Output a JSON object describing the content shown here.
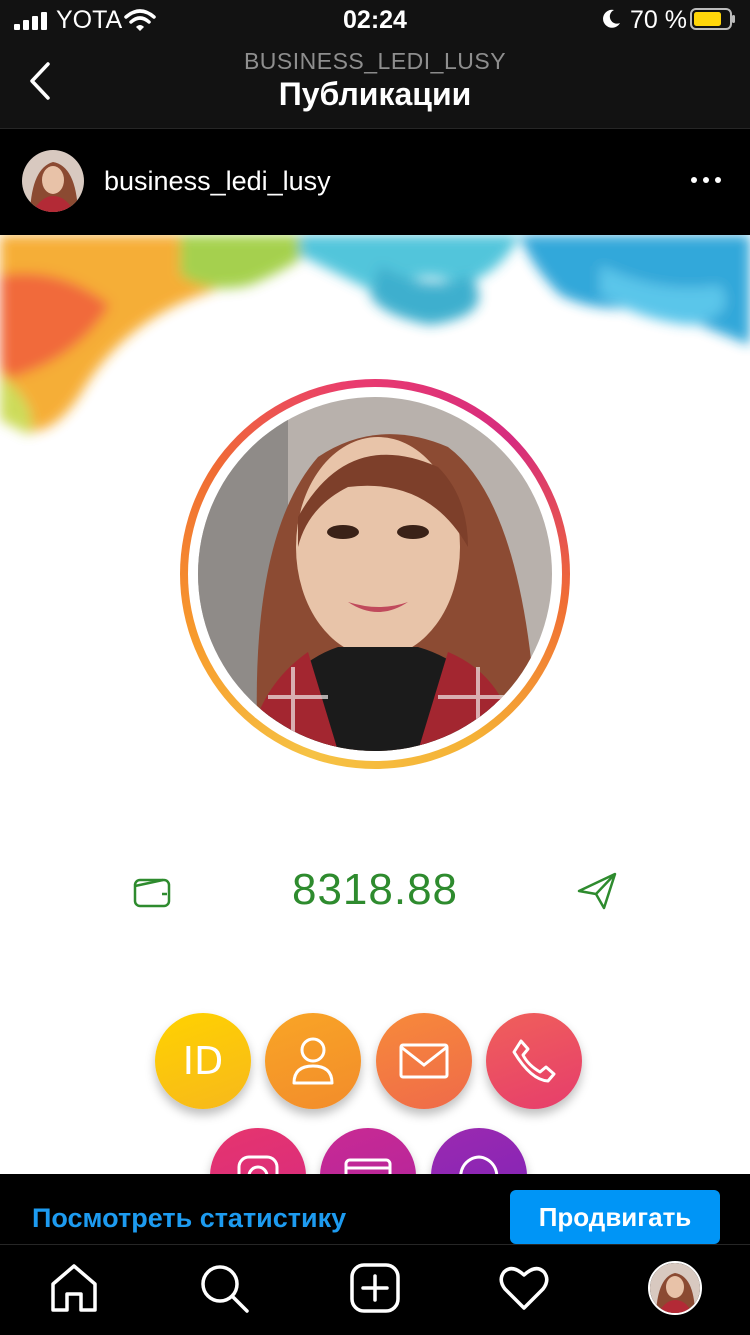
{
  "status_bar": {
    "carrier": "YOTA",
    "time": "02:24",
    "battery_percent": "70 %",
    "icons": [
      "signal-icon",
      "wifi-icon",
      "moon-icon",
      "battery-icon"
    ]
  },
  "nav": {
    "subtitle": "BUSINESS_LEDI_LUSY",
    "title": "Публикации"
  },
  "post": {
    "username": "business_ledi_lusy",
    "balance": "8318.88",
    "circle_buttons": [
      {
        "icon": "id-icon",
        "label": "ID"
      },
      {
        "icon": "user-icon"
      },
      {
        "icon": "mail-icon"
      },
      {
        "icon": "phone-icon"
      },
      {
        "icon": "instagram-icon"
      },
      {
        "icon": "card-icon"
      },
      {
        "icon": "whatsapp-icon"
      }
    ]
  },
  "actions": {
    "stats_link": "Посмотреть статистику",
    "promote_label": "Продвигать"
  },
  "tabbar": {
    "items": [
      "home-icon",
      "search-icon",
      "add-post-icon",
      "activity-heart-icon",
      "profile-avatar"
    ]
  },
  "colors": {
    "link_blue": "#1d9bf0",
    "button_blue": "#0095f6",
    "balance_green": "#2e8b2e",
    "battery_yellow": "#ffd60a"
  }
}
